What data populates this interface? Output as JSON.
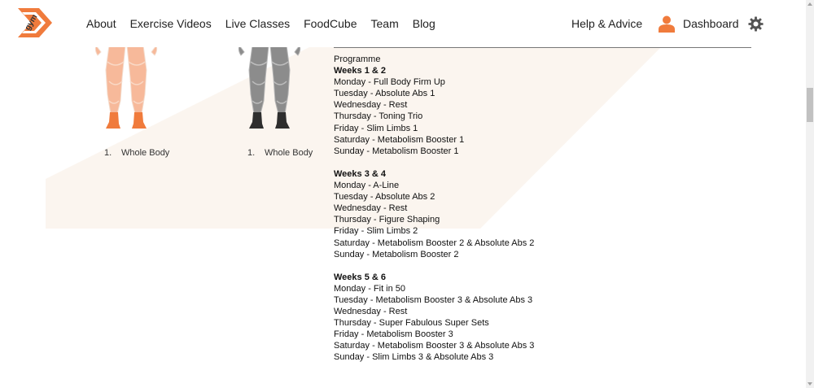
{
  "brand": {
    "logo_text": "gym cube",
    "accent": "#f07b3c"
  },
  "nav": {
    "items": [
      {
        "label": "About"
      },
      {
        "label": "Exercise Videos"
      },
      {
        "label": "Live Classes"
      },
      {
        "label": "FoodCube"
      },
      {
        "label": "Team"
      },
      {
        "label": "Blog"
      }
    ],
    "help_label": "Help & Advice",
    "dashboard_label": "Dashboard"
  },
  "figures": [
    {
      "number": "1.",
      "label": "Whole Body",
      "color": "#f7b99a"
    },
    {
      "number": "1.",
      "label": "Whole Body",
      "color": "#8c8c8c"
    }
  ],
  "programme": {
    "title": "Programme",
    "blocks": [
      {
        "heading": "Weeks 1 & 2",
        "lines": [
          "Monday - Full Body Firm Up",
          "Tuesday - Absolute Abs 1",
          "Wednesday - Rest",
          "Thursday - Toning Trio",
          "Friday - Slim Limbs 1",
          "Saturday  - Metabolism Booster 1",
          "Sunday  - Metabolism Booster 1"
        ]
      },
      {
        "heading": "Weeks 3 & 4",
        "lines": [
          "Monday - A-Line",
          "Tuesday - Absolute Abs 2",
          "Wednesday - Rest",
          "Thursday - Figure Shaping",
          "Friday - Slim Limbs 2",
          "Saturday - Metabolism Booster 2 & Absolute Abs 2",
          "Sunday  - Metabolism Booster 2"
        ]
      },
      {
        "heading": "Weeks 5 & 6",
        "lines": [
          "Monday - Fit in 50",
          "Tuesday - Metabolism Booster 3 & Absolute Abs 3",
          "Wednesday - Rest",
          "Thursday - Super Fabulous Super Sets",
          "Friday - Metabolism Booster 3",
          "Saturday  - Metabolism Booster 3 & Absolute Abs 3",
          "Sunday  - Slim Limbs 3 & Absolute Abs 3"
        ]
      }
    ]
  }
}
